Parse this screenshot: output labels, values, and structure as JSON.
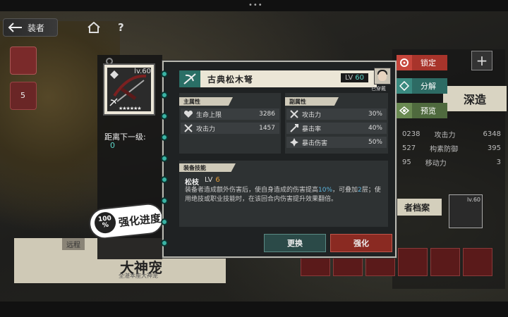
{
  "nav": {
    "back_label": "装者"
  },
  "popup": {
    "weapon_name": "古典松木弩",
    "level_prefix": "LV",
    "level": "60",
    "equipped_label": "已穿戴",
    "main_attr_title": "主属性",
    "sub_attr_title": "副属性",
    "main_stats": [
      {
        "label": "生命上限",
        "value": "3286",
        "icon": "heart-icon"
      },
      {
        "label": "攻击力",
        "value": "1457",
        "icon": "crossed-swords-icon"
      }
    ],
    "sub_stats": [
      {
        "label": "攻击力",
        "value": "30%",
        "icon": "crossed-swords-icon"
      },
      {
        "label": "暴击率",
        "value": "40%",
        "icon": "crit-icon"
      },
      {
        "label": "暴击伤害",
        "value": "50%",
        "icon": "crit-damage-icon"
      }
    ],
    "skill_title": "装备技能",
    "skill_name": "松枝",
    "skill_lv_prefix": "LV",
    "skill_lv": "6",
    "skill_desc_1": "装备者造成额外伤害后，使自身造成的伤害提高",
    "skill_desc_hl1": "10%",
    "skill_desc_2": "，可叠加",
    "skill_desc_hl2": "2",
    "skill_desc_3": "层；使用绝技或职业技能时，在该回合内伤害提升效果翻倍。",
    "btn_change": "更换",
    "btn_enhance": "强化"
  },
  "actions": {
    "lock": "锁定",
    "decompose": "分解",
    "preview": "预览"
  },
  "side": {
    "level": "lv.60",
    "next_level_label": "距离下一级:",
    "next_level_value": "0",
    "progress_pct": "100",
    "progress_unit": "%",
    "progress_label": "强化进度"
  },
  "background": {
    "deep_build": "深造",
    "archive": "者档案",
    "bottom_tag": "远程",
    "bottom_title": "大神宠",
    "bottom_sub": "全湛本座大神宠",
    "badge_count": "5",
    "stats": [
      {
        "left": "0238",
        "label": "攻击力",
        "value": "6348"
      },
      {
        "left": "527",
        "label": "构素防御",
        "value": "395"
      },
      {
        "left": "95",
        "label": "移动力",
        "value": "3"
      }
    ]
  },
  "colors": {
    "accent_teal": "#3ab3a4",
    "enhance_red": "#8a2a22",
    "highlight_blue": "#5db6e0",
    "skill_lv_orange": "#e8a03a"
  }
}
